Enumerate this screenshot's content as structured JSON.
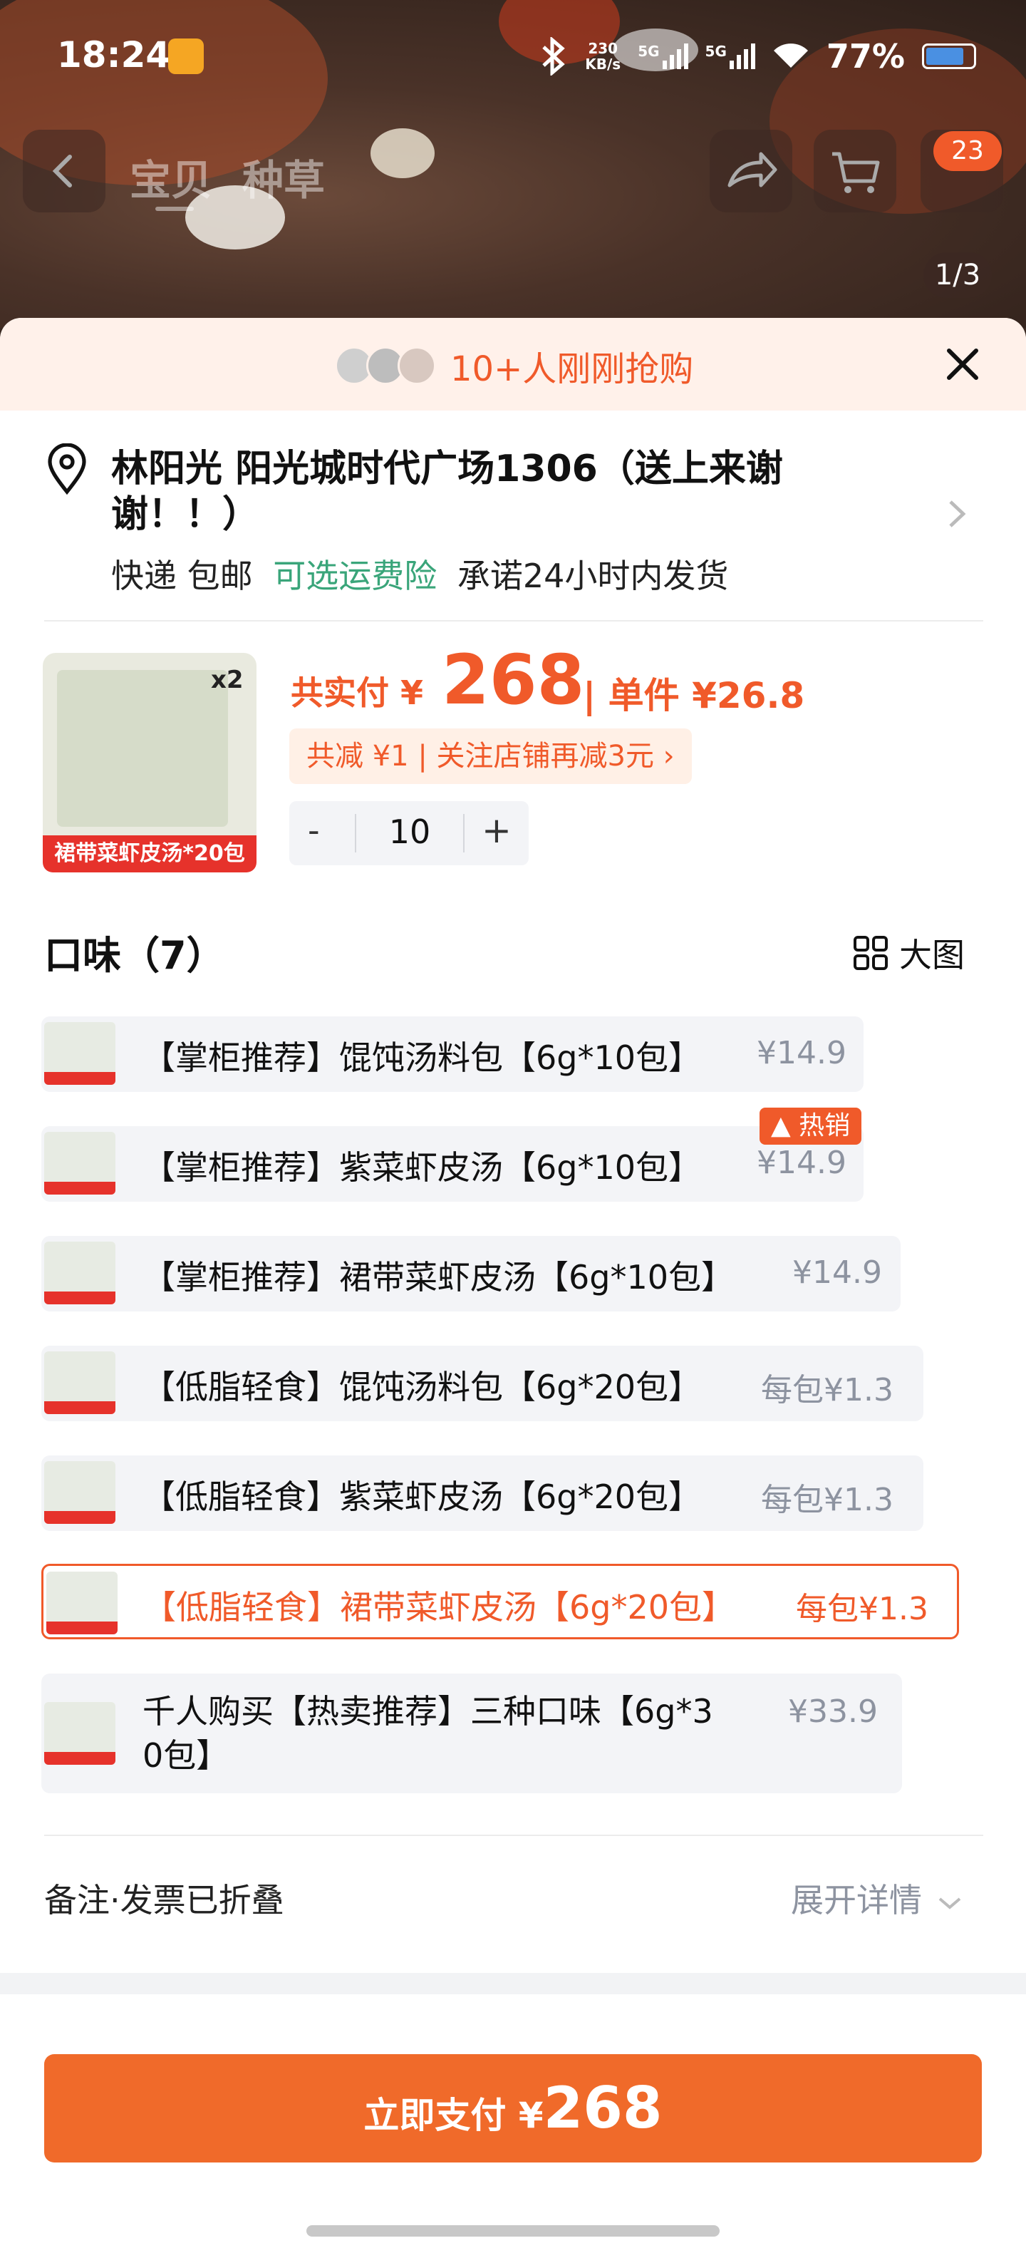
{
  "status_bar": {
    "time": "18:24",
    "network_speed_value": "230",
    "network_speed_unit": "KB/s",
    "signal1_label": "5G",
    "signal2_label": "5G",
    "battery": "77%"
  },
  "nav": {
    "tabs": [
      "宝贝",
      "种草"
    ],
    "cart_badge": "23",
    "page_indicator": "1/3"
  },
  "banner": {
    "text": "10+人刚刚抢购"
  },
  "address": {
    "line": "林阳光 阳光城时代广场1306（送上来谢谢！！）",
    "shipping": "快递 包邮",
    "insurance": "可选运费险",
    "promise": "承诺24小时内发货"
  },
  "product": {
    "image_tag": "裙带菜虾皮汤*20包",
    "image_multiplier": "x2",
    "total_label": "共实付 ¥",
    "total_price": "268",
    "unit_label": "| 单件 ¥26.8",
    "discount": "共减 ¥1 | 关注店铺再减3元 ›",
    "qty_minus": "-",
    "qty_value": "10",
    "qty_plus": "+"
  },
  "flavors": {
    "title": "口味（7）",
    "big_image_label": "大图",
    "hot_label": "热销",
    "options": [
      {
        "name": "【掌柜推荐】馄饨汤料包【6g*10包】",
        "price": "¥14.9",
        "selected": false
      },
      {
        "name": "【掌柜推荐】紫菜虾皮汤【6g*10包】",
        "price": "¥14.9",
        "selected": false
      },
      {
        "name": "【掌柜推荐】裙带菜虾皮汤【6g*10包】",
        "price": "¥14.9",
        "selected": false
      },
      {
        "name": "【低脂轻食】馄饨汤料包【6g*20包】",
        "price": "每包¥1.3",
        "selected": false
      },
      {
        "name": "【低脂轻食】紫菜虾皮汤【6g*20包】",
        "price": "每包¥1.3",
        "selected": false
      },
      {
        "name": "【低脂轻食】裙带菜虾皮汤【6g*20包】",
        "price": "每包¥1.3",
        "selected": true
      },
      {
        "name_line1": "千人购买【热卖推荐】三种口味【6g*3",
        "name_line2": "0包】",
        "price": "¥33.9",
        "selected": false
      }
    ]
  },
  "notes": {
    "label": "备注·发票已折叠",
    "expand": "展开详情"
  },
  "pay": {
    "label": "立即支付 ¥",
    "amount": "268"
  },
  "colors": {
    "accent": "#f05a2a",
    "button": "#f06a2a",
    "tag_red": "#e6322b",
    "green": "#3aa57a"
  }
}
